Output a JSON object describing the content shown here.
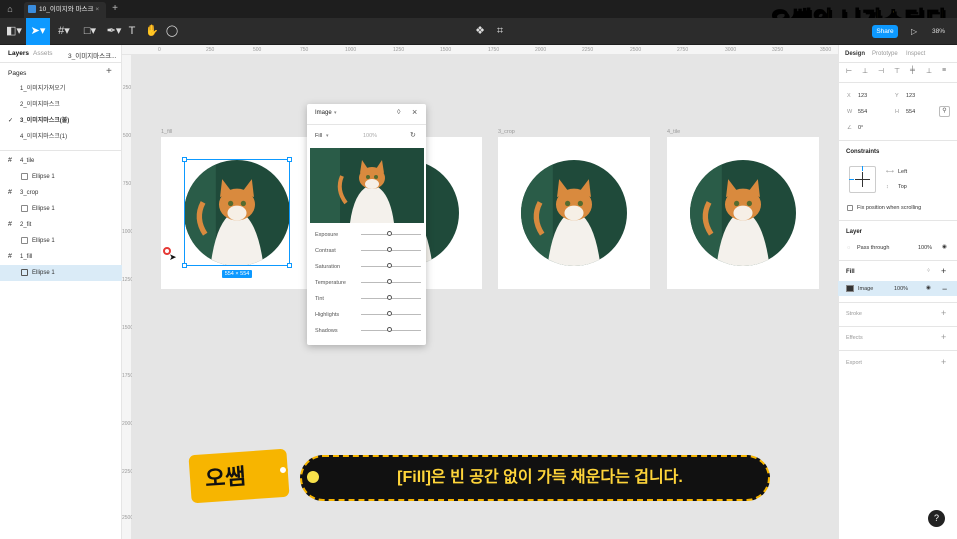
{
  "tabs": {
    "home_icon": "home-icon",
    "file_name": "10_이미지와 마스크",
    "add": "+"
  },
  "watermark": "오쌤의 니가스터디",
  "toolbar": {
    "share_label": "Share",
    "zoom": "38%"
  },
  "left_panel": {
    "tab_layers": "Layers",
    "tab_assets": "Assets",
    "current_page": "3_이미지마스크...",
    "pages_header": "Pages",
    "add_page": "+",
    "pages": [
      "1_이미지가져오기",
      "2_이미지마스크",
      "3_이미지마스크(불)",
      "4_이미지마스크(1)"
    ],
    "layers": [
      {
        "name": "4_tile",
        "type": "frame"
      },
      {
        "name": "Ellipse 1",
        "type": "ellipse"
      },
      {
        "name": "3_crop",
        "type": "frame"
      },
      {
        "name": "Ellipse 1",
        "type": "ellipse"
      },
      {
        "name": "2_fit",
        "type": "frame"
      },
      {
        "name": "Ellipse 1",
        "type": "ellipse"
      },
      {
        "name": "1_fill",
        "type": "frame"
      },
      {
        "name": "Ellipse 1",
        "type": "ellipse",
        "selected": true
      }
    ]
  },
  "rulers": {
    "top": [
      "0",
      "250",
      "500",
      "750",
      "1000",
      "1250",
      "1500",
      "1750",
      "2000",
      "2250",
      "2500",
      "2750",
      "3000",
      "3250",
      "3500"
    ],
    "left": [
      "250",
      "500",
      "750",
      "1000",
      "1250",
      "1500",
      "1750",
      "2000",
      "2250",
      "2500",
      "2750",
      "3000"
    ]
  },
  "canvas": {
    "frames": [
      "1_fill",
      "",
      "3_crop",
      "4_tile"
    ],
    "selection_size": "554 × 554"
  },
  "image_popup": {
    "title": "Image",
    "fill_mode": "Fill",
    "fill_percent": "100%",
    "adjustments": [
      "Exposure",
      "Contrast",
      "Saturation",
      "Temperature",
      "Tint",
      "Highlights",
      "Shadows"
    ]
  },
  "right_panel": {
    "tab_design": "Design",
    "tab_prototype": "Prototype",
    "tab_inspect": "Inspect",
    "x_label": "X",
    "x_value": "123",
    "y_label": "Y",
    "y_value": "123",
    "w_label": "W",
    "w_value": "554",
    "h_label": "H",
    "h_value": "554",
    "rotation": "0°",
    "constraints_header": "Constraints",
    "constraint_h": "Left",
    "constraint_v": "Top",
    "fix_position": "Fix position when scrolling",
    "layer_header": "Layer",
    "blend_mode": "Pass through",
    "layer_opacity": "100%",
    "fill_header": "Fill",
    "fill_type": "Image",
    "fill_opacity": "100%",
    "stroke_header": "Stroke",
    "effects_header": "Effects",
    "export_header": "Export"
  },
  "caption": {
    "tag": "오쌤",
    "text": "[Fill]은 빈 공간 없이 가득 채운다는 겁니다."
  },
  "help": "?"
}
